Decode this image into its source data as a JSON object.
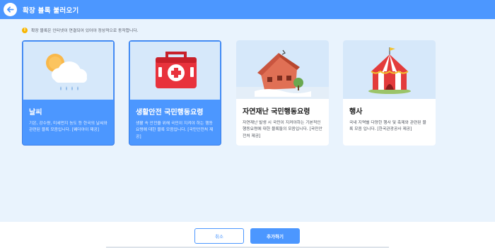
{
  "header": {
    "title": "확장 블록 불러오기",
    "back_icon": "arrow-left-icon",
    "bg_color": "#4c97ff"
  },
  "notice": {
    "icon": "info-icon",
    "icon_glyph": "!",
    "text": "확장 블록은 인터넷이 연결되어 있어야 정상적으로 동작합니다."
  },
  "cards": [
    {
      "title": "날씨",
      "description": "기온, 강수량, 미세먼지 농도 등 한국의 날씨와 관련된 블록 모음입니다. [웨더아이 제공]",
      "selected": true,
      "icon": "weather-icon"
    },
    {
      "title": "생활안전 국민행동요령",
      "description": "생활 속 안전을 위해 국민이 지켜야 하는 행동요령에 대한 블록 모음입니다. [국민안전처 제공]",
      "selected": true,
      "icon": "first-aid-kit-icon"
    },
    {
      "title": "자연재난 국민행동요령",
      "description": "자연재난 발생 시 국민이 지켜야하는 기본적인 행동요령에 대한 블록들의 모음입니다. [국민안전처 제공]",
      "selected": false,
      "icon": "damaged-house-icon"
    },
    {
      "title": "행사",
      "description": "국내 지역별 다양한 행사 및 축제와 관련된 블록 모음 입니다. [한국관광공사 제공]",
      "selected": false,
      "icon": "circus-tent-icon"
    }
  ],
  "footer": {
    "cancel_label": "취소",
    "add_label": "추가하기"
  }
}
